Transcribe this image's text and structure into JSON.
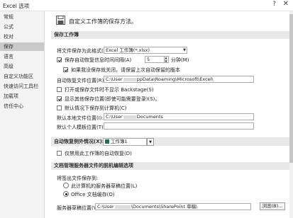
{
  "window": {
    "title": "Excel 选项",
    "help_glyph": "?",
    "close_glyph": "✕"
  },
  "sidebar": {
    "items": [
      {
        "label": "常规"
      },
      {
        "label": "公式"
      },
      {
        "label": "校对"
      },
      {
        "label": "保存"
      },
      {
        "label": "语言"
      },
      {
        "label": "高级"
      },
      {
        "label": "自定义功能区"
      },
      {
        "label": "快速访问工具栏"
      },
      {
        "label": "加载项"
      },
      {
        "label": "信任中心"
      }
    ],
    "active_index": 3
  },
  "header": {
    "icon": "save-disk-icon",
    "text": "自定义工作簿的保存方法。"
  },
  "save_workbooks": {
    "section_title": "保存工作簿",
    "format_label": "将文件保存为此格式(F):",
    "format_value": "Excel 工作簿(*.xlsx)",
    "autorecover_label": "保存自动恢复信息时间间隔(A)",
    "autorecover_checked": true,
    "autorecover_minutes": "5",
    "minutes_label": "分钟(M)",
    "keep_last_label": "如果我没保存就关闭，请保留上次自动保留的版本",
    "keep_last_checked": true,
    "autorecover_location_label": "自动恢复文件位置(R):",
    "autorecover_location_prefix": "C:\\User",
    "autorecover_location_suffix": "ppData\\Roaming\\Microsoft\\Excel\\",
    "backstage_label": "打开或保存文件时不显示 Backstage(S)",
    "backstage_checked": false,
    "show_places_label": "显示其他保存位置(即使可能需要登录)(S)。",
    "show_places_checked": true,
    "default_computer_label": "默认情况下保存到计算机(C)",
    "default_computer_checked": false,
    "default_local_label": "默认本地文件位置(I):",
    "default_local_prefix": "C:\\User",
    "default_local_suffix": "Documents",
    "personal_template_label": "默认个人模板位置(T):",
    "personal_template_value": ""
  },
  "autorecover_exceptions": {
    "label": "自动恢复例外情况(X):",
    "workbook": "工作簿1",
    "disable_label": "仅禁用此工作簿的自动恢复(D)",
    "disable_checked": false
  },
  "offline_editing": {
    "section_title": "文档管理服务器文件的脱机编辑选项",
    "save_checked_out_label": "将签出文件保存到:",
    "radio_server_drafts": "此计算机的服务器草稿位置(L)",
    "radio_office_cache": "Office 文档缓存(O)",
    "selected": "office_cache",
    "server_drafts_label": "服务器草稿位置(V):",
    "server_drafts_prefix": "C:\\User",
    "server_drafts_suffix": "\\Documents\\SharePoint 草稿\\",
    "browse_button": "浏览(B)..."
  }
}
